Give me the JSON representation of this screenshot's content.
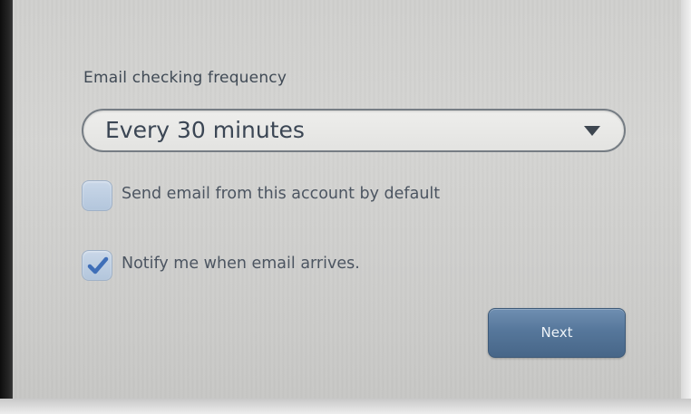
{
  "settings": {
    "frequency_label": "Email checking frequency",
    "frequency_value": "Every 30 minutes",
    "default_account_label": "Send email from this account by default",
    "default_account_checked": false,
    "notify_label": "Notify me when email arrives.",
    "notify_checked": true
  },
  "actions": {
    "next_label": "Next"
  },
  "icons": {
    "dropdown": "chevron-down-icon",
    "checkmark": "checkmark-icon"
  },
  "colors": {
    "accent_button": "#56779b",
    "checkmark": "#3f6fb8",
    "checkbox_fill": "#bfd0e4"
  }
}
